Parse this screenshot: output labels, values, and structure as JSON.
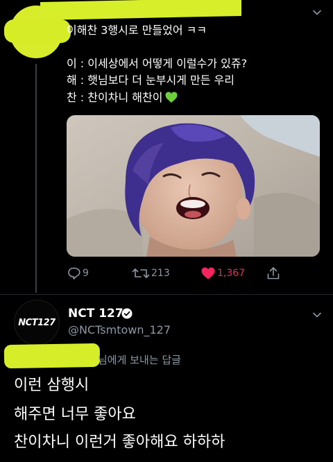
{
  "tweet": {
    "text_lines": [
      "이해찬 3행시로 만들었어 ㅋㅋ",
      "이 : 이세상에서 어떻게 이럴수가 있쥬?",
      "해 : 햇님보다 더 눈부시게 만든 우리",
      "찬 : 찬이차니 해찬이"
    ],
    "emoji": "green-heart",
    "replies": "9",
    "retweets": "213",
    "likes": "1,367"
  },
  "reply": {
    "display_name": "NCT 127",
    "handle": "@NCTsmtown_127",
    "avatar_logo_text": "NCT127",
    "replying_to": "님에게 보내는 답글",
    "text_lines": [
      "이런 삼행시",
      "해주면 너무 좋아요",
      "찬이차니 이런거 좋아해요 하하하"
    ]
  },
  "colors": {
    "background": "#000000",
    "highlighter": "#d7ee2a",
    "muted": "#8b98a5",
    "like_active": "#f4245e",
    "green_heart": "#6ad13a"
  }
}
